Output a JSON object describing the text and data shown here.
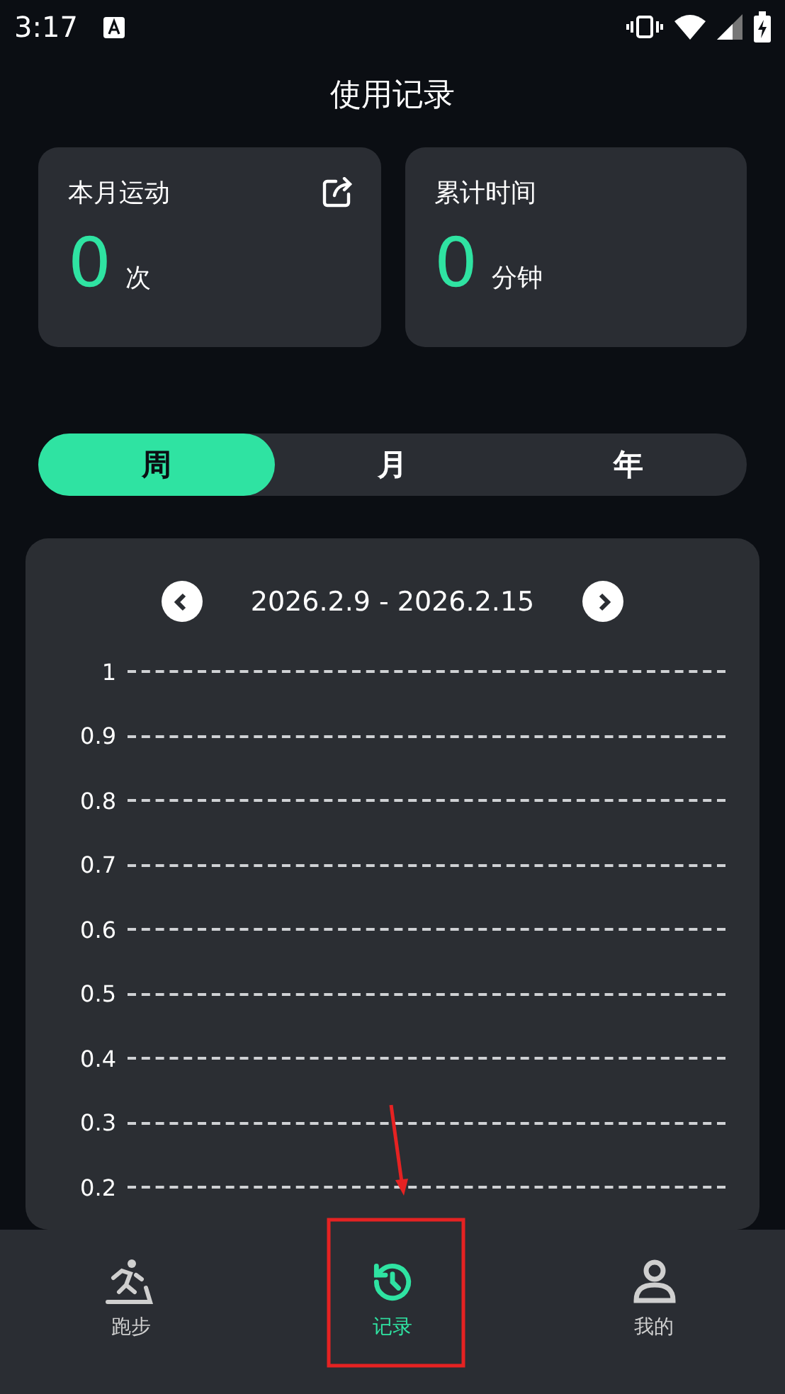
{
  "status_bar": {
    "time": "3:17"
  },
  "title": "使用记录",
  "stats": [
    {
      "label": "本月运动",
      "value": "0",
      "unit": "次",
      "share": true
    },
    {
      "label": "累计时间",
      "value": "0",
      "unit": "分钟",
      "share": false
    }
  ],
  "periods": [
    {
      "label": "周",
      "selected": true
    },
    {
      "label": "月",
      "selected": false
    },
    {
      "label": "年",
      "selected": false
    }
  ],
  "chart": {
    "range": "2026.2.9 - 2026.2.15",
    "axis_labels": [
      "1",
      "0.9",
      "0.8",
      "0.7",
      "0.6",
      "0.5",
      "0.4",
      "0.3",
      "0.2"
    ]
  },
  "nav": [
    {
      "label": "跑步",
      "kind": "run",
      "selected": false
    },
    {
      "label": "记录",
      "kind": "history",
      "selected": true
    },
    {
      "label": "我的",
      "kind": "profile",
      "selected": false
    }
  ]
}
